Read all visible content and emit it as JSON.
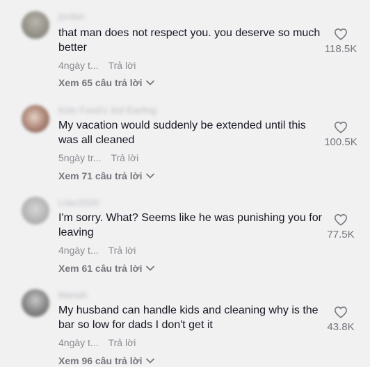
{
  "comments": [
    {
      "username": "jordan",
      "text": "that man does not respect you. you deserve so much better",
      "time": "4ngày t...",
      "reply_label": "Trả lời",
      "view_replies": "Xem 65 câu trả lời",
      "likes": "118.5K",
      "avatar_color": "#9a9a92"
    },
    {
      "username": "Kids Food's 3rd Earling",
      "text": "My vacation would suddenly be extended until this was all cleaned",
      "time": "5ngày tr...",
      "reply_label": "Trả lời",
      "view_replies": "Xem 71 câu trả lời",
      "likes": "100.5K",
      "avatar_color": "#a57b70"
    },
    {
      "username": "Lilac2020",
      "text": "I'm sorry. What? Seems like he was punishing you for leaving",
      "time": "4ngày t...",
      "reply_label": "Trả lời",
      "view_replies": "Xem 61 câu trả lời",
      "likes": "77.5K",
      "avatar_color": "#b7b7b7"
    },
    {
      "username": "Mariah",
      "text": "My husband can handle kids and cleaning why is the bar so low for dads I don't get it",
      "time": "4ngày t...",
      "reply_label": "Trả lời",
      "view_replies": "Xem 96 câu trả lời",
      "likes": "43.8K",
      "avatar_color": "#8e8e8e"
    }
  ],
  "icons": {
    "heart": "heart-outline-icon",
    "chevron": "chevron-down-icon"
  }
}
